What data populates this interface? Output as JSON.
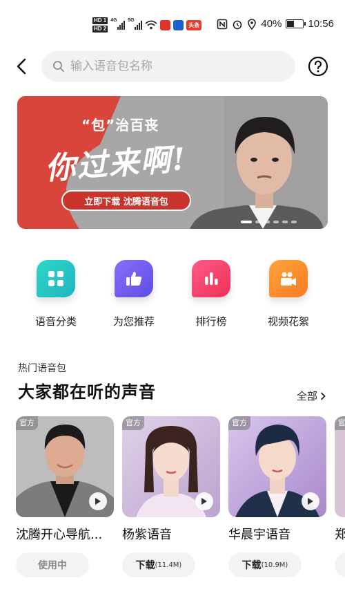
{
  "status_bar": {
    "hd1": "HD 1",
    "hd2": "HD 2",
    "net1": "4G",
    "net2": "5G",
    "app_badge": "头条",
    "battery": "40%",
    "time": "10:56"
  },
  "search": {
    "placeholder": "输入语音包名称"
  },
  "banner": {
    "subtitle": "“包”治百丧",
    "title": "你过来啊!",
    "button": "立即下载 沈腾语音包",
    "slide_count": 6,
    "active_slide": 1
  },
  "categories": [
    {
      "label": "语音分类",
      "icon": "grid-icon",
      "color": "#2fc6c0"
    },
    {
      "label": "为您推荐",
      "icon": "thumbs-up-icon",
      "color": "#6d5cf0"
    },
    {
      "label": "排行榜",
      "icon": "bar-chart-icon",
      "color": "#f2436a"
    },
    {
      "label": "视频花絮",
      "icon": "video-camera-icon",
      "color": "#fb8a2e"
    }
  ],
  "section": {
    "small_title": "热门语音包",
    "title": "大家都在听的声音",
    "all_label": "全部"
  },
  "voices": [
    {
      "badge": "官方",
      "name": "沈腾开心导航...",
      "action": "使用中",
      "size": ""
    },
    {
      "badge": "官方",
      "name": "杨紫语音",
      "action": "下载",
      "size": "(11.4M)"
    },
    {
      "badge": "官方",
      "name": "华晨宇语音",
      "action": "下载",
      "size": "(10.9M)"
    },
    {
      "badge": "官方",
      "name": "郑",
      "action": "",
      "size": ""
    }
  ]
}
